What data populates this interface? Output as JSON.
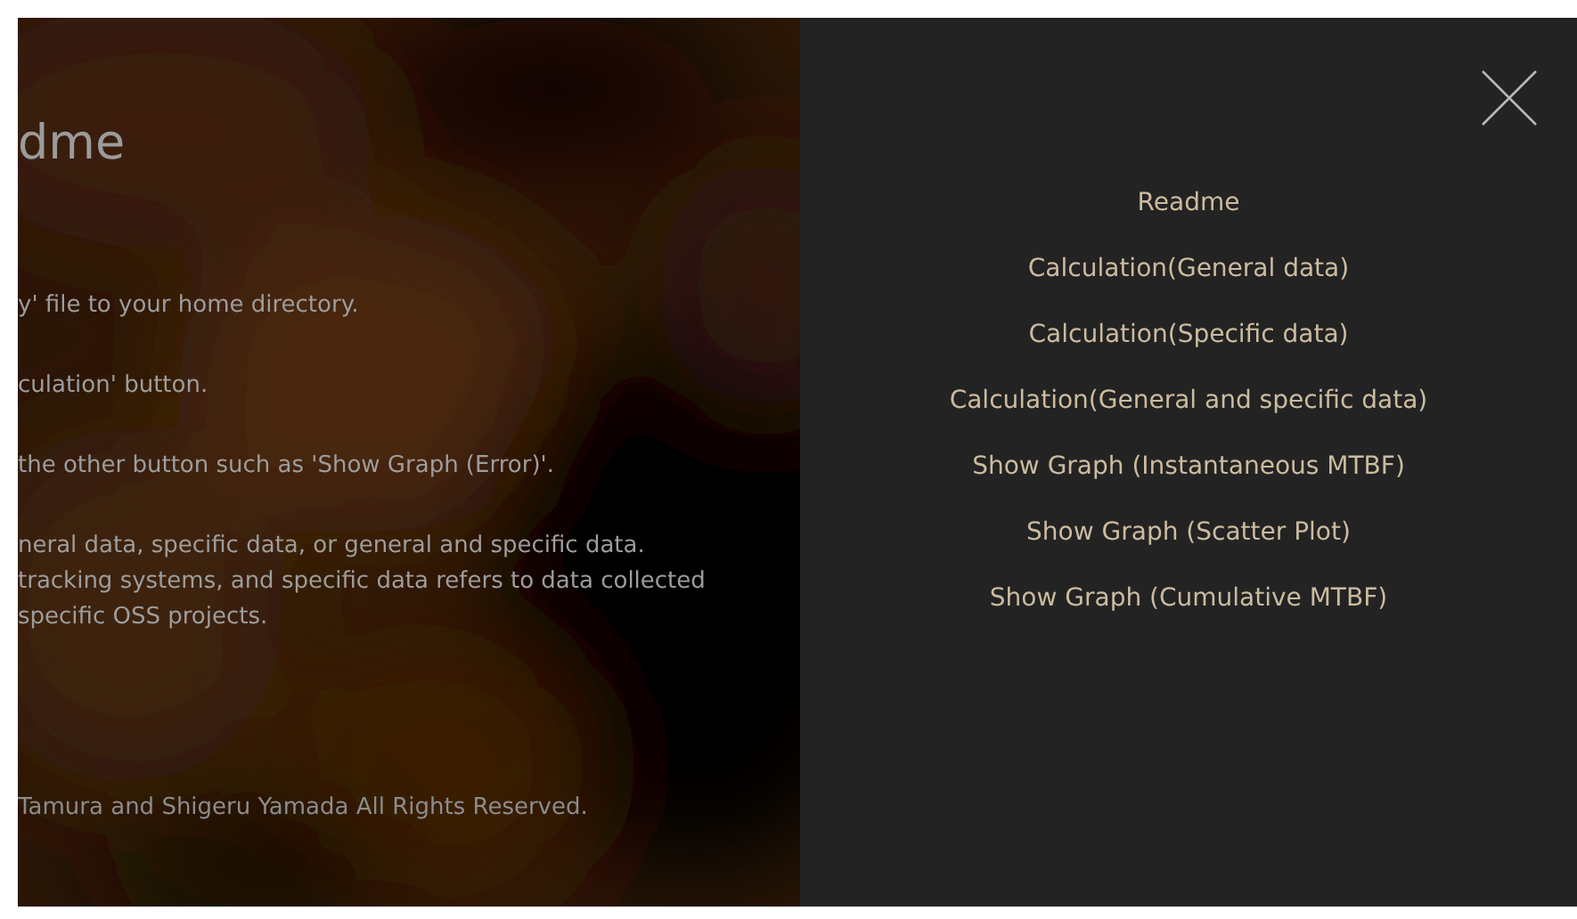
{
  "readme": {
    "title": "dme",
    "paragraphs": [
      [
        "y' file to your home directory."
      ],
      [
        "culation' button."
      ],
      [
        " the other button such as 'Show Graph (Error)'."
      ],
      [
        "neral data, specific data, or general and specific data.",
        "tracking systems, and specific data refers to data collected",
        "specific OSS projects."
      ]
    ],
    "footer": "Tamura and Shigeru Yamada All Rights Reserved."
  },
  "menu": {
    "items": [
      "Readme",
      "Calculation(General data)",
      "Calculation(Specific data)",
      "Calculation(General and specific data)",
      "Show Graph (Instantaneous MTBF)",
      "Show Graph (Scatter Plot)",
      "Show Graph (Cumulative MTBF)"
    ]
  }
}
